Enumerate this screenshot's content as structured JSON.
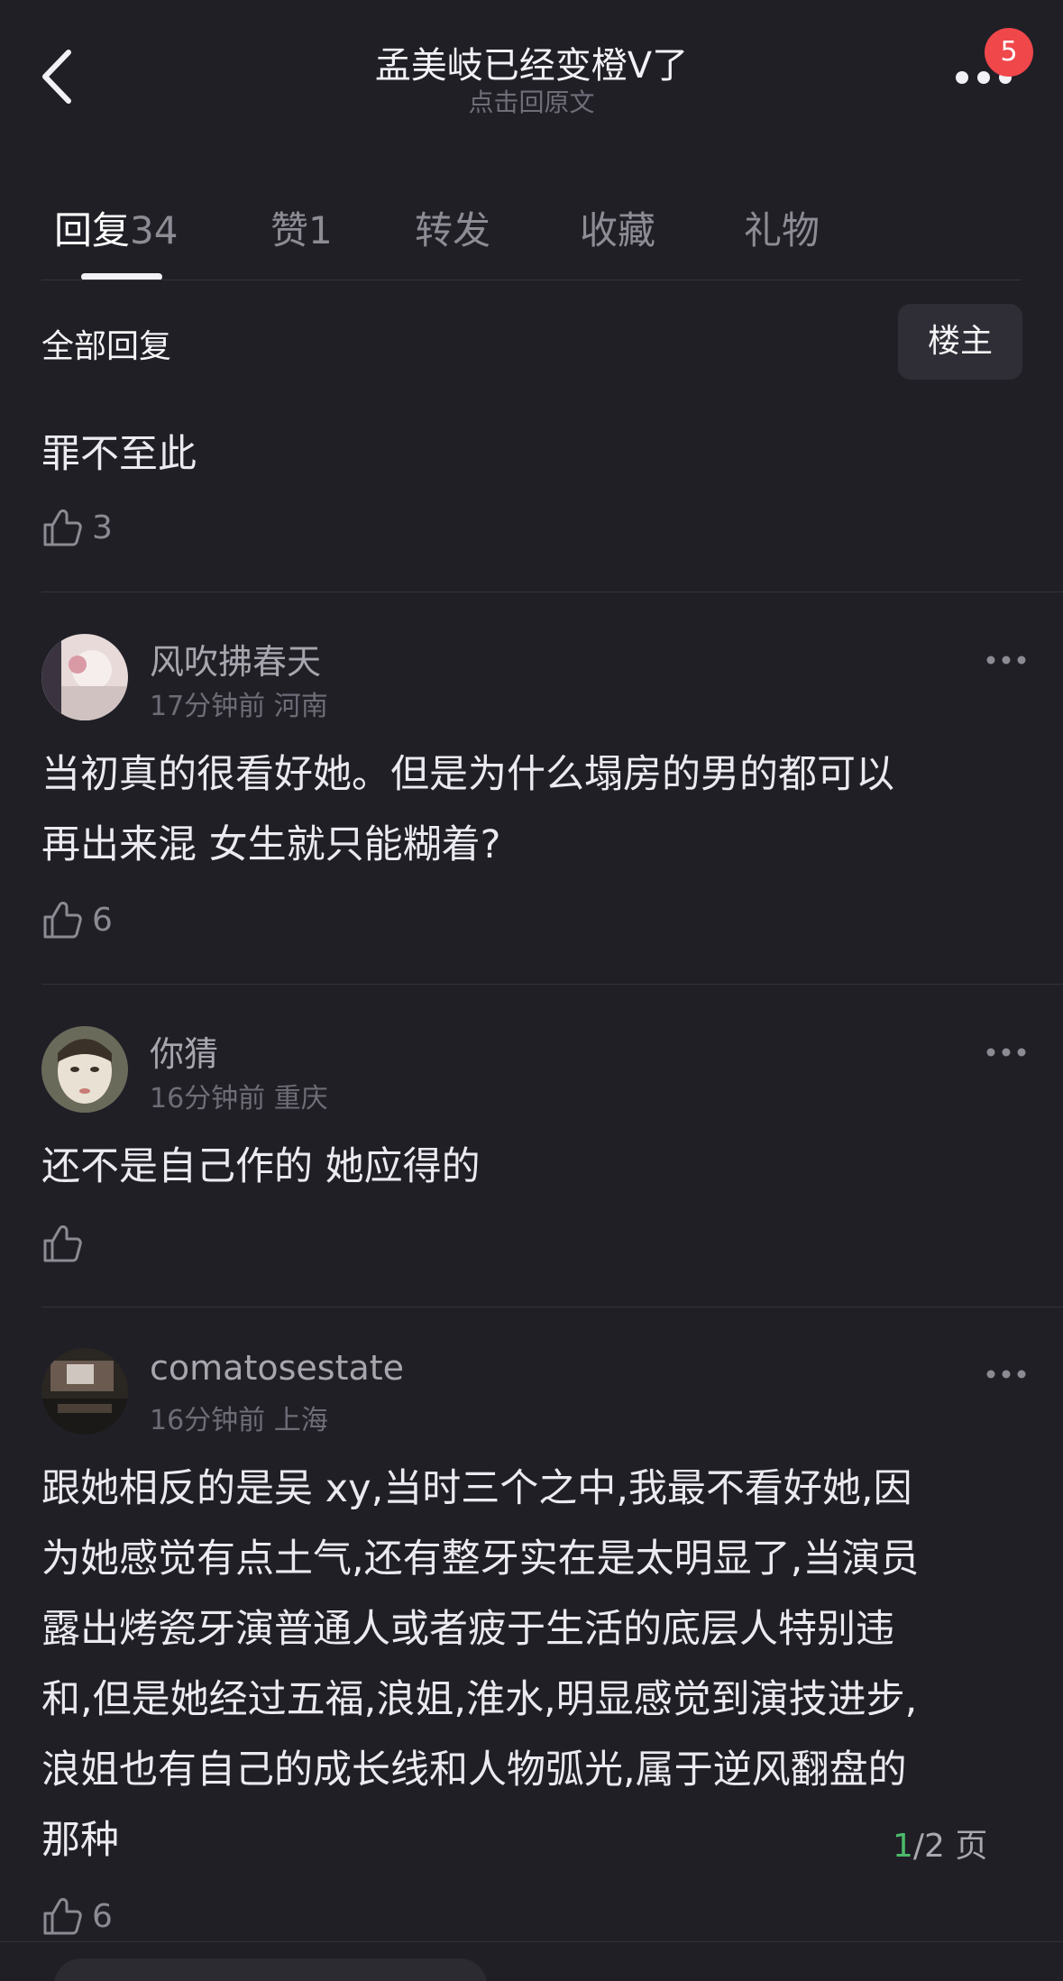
{
  "header": {
    "title": "孟美岐已经变橙Ⅴ了",
    "subtitle": "点击回原文",
    "badge_count": "5"
  },
  "tabs": [
    {
      "label": "回复",
      "count": "34",
      "active": true
    },
    {
      "label": "赞",
      "count": "1"
    },
    {
      "label": "转发",
      "count": ""
    },
    {
      "label": "收藏",
      "count": ""
    },
    {
      "label": "礼物",
      "count": ""
    }
  ],
  "filter": {
    "title": "全部回复",
    "op_button": "楼主"
  },
  "first_reply": {
    "text": "罪不至此",
    "likes": "3"
  },
  "comments": [
    {
      "user": "风吹拂春天",
      "time": "17分钟前",
      "location": "河南",
      "lines": [
        "当初真的很看好她。但是为什么塌房的男的都可以",
        "再出来混 女生就只能糊着?"
      ],
      "likes": "6"
    },
    {
      "user": "你猜",
      "time": "16分钟前",
      "location": "重庆",
      "lines": [
        "还不是自己作的 她应得的"
      ],
      "likes": ""
    },
    {
      "user": "comatosestate",
      "time": "16分钟前",
      "location": "上海",
      "lines": [
        "跟她相反的是吴 xy,当时三个之中,我最不看好她,因",
        "为她感觉有点土气,还有整牙实在是太明显了,当演员",
        "露出烤瓷牙演普通人或者疲于生活的底层人特别违",
        "和,但是她经过五福,浪姐,淮水,明显感觉到演技进步,",
        "浪姐也有自己的成长线和人物弧光,属于逆风翻盘的",
        "那种"
      ],
      "likes": "6"
    }
  ],
  "page_indicator": {
    "current": "1",
    "rest": "/2 页"
  },
  "icons": [
    "back-arrow-icon",
    "more-icon",
    "thumb-up-icon",
    "more-dots-icon"
  ],
  "colors": {
    "background": "#201f26",
    "badge": "#f0474b",
    "page_current": "#4cbb6b"
  }
}
